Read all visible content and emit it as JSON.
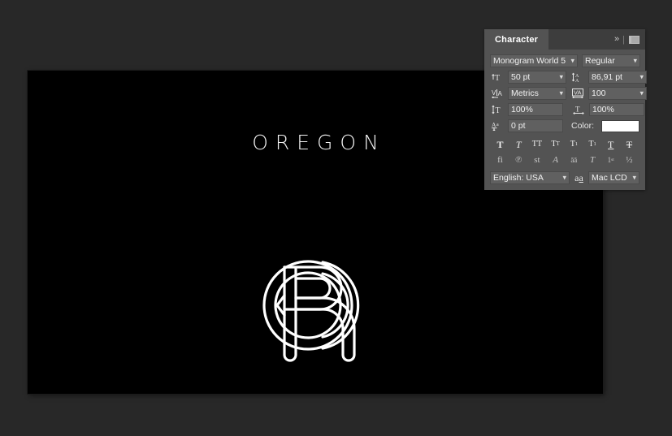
{
  "canvas": {
    "wordmark": "OREGON",
    "background_color": "#000000",
    "artwork_color": "#ffffff",
    "artwork_name": "interlocking-o-r-monogram"
  },
  "workspace": {
    "background_color": "#282828"
  },
  "character_panel": {
    "tab_label": "Character",
    "collapse_glyph": "»",
    "separator_glyph": "|",
    "font_family": "Monogram World 5",
    "font_style": "Regular",
    "font_size": "50 pt",
    "leading": "86,91 pt",
    "kerning": "Metrics",
    "tracking": "100",
    "vertical_scale": "100%",
    "horizontal_scale": "100%",
    "baseline_shift": "0 pt",
    "color_label": "Color:",
    "color_value": "#ffffff",
    "language": "English: USA",
    "antialias": "Mac LCD",
    "style_buttons": [
      {
        "name": "faux-bold",
        "glyph": "T"
      },
      {
        "name": "faux-italic",
        "glyph": "T"
      },
      {
        "name": "all-caps",
        "glyph": "TT"
      },
      {
        "name": "small-caps",
        "glyph": "Tт"
      },
      {
        "name": "superscript",
        "glyph": "T"
      },
      {
        "name": "subscript",
        "glyph": "T"
      },
      {
        "name": "underline",
        "glyph": "T"
      },
      {
        "name": "strikethrough",
        "glyph": "T"
      }
    ],
    "opentype_buttons": [
      {
        "name": "standard-ligatures",
        "glyph": "fi"
      },
      {
        "name": "contextual-alternates",
        "glyph": "℘"
      },
      {
        "name": "discretionary-ligatures",
        "glyph": "st"
      },
      {
        "name": "swash",
        "glyph": "А"
      },
      {
        "name": "oldstyle",
        "glyph": "aa"
      },
      {
        "name": "titling-alternates",
        "glyph": "T"
      },
      {
        "name": "ordinals",
        "glyph": "1st"
      },
      {
        "name": "fractions",
        "glyph": "½"
      }
    ]
  }
}
